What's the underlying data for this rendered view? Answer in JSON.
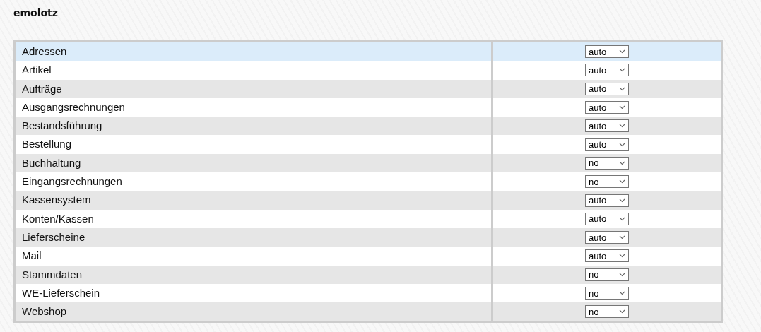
{
  "title": "emolotz",
  "rows": [
    {
      "name": "Adressen",
      "value": "auto",
      "selected": true
    },
    {
      "name": "Artikel",
      "value": "auto",
      "selected": false
    },
    {
      "name": "Aufträge",
      "value": "auto",
      "selected": false
    },
    {
      "name": "Ausgangsrechnungen",
      "value": "auto",
      "selected": false
    },
    {
      "name": "Bestandsführung",
      "value": "auto",
      "selected": false
    },
    {
      "name": "Bestellung",
      "value": "auto",
      "selected": false
    },
    {
      "name": "Buchhaltung",
      "value": "no",
      "selected": false
    },
    {
      "name": "Eingangsrechnungen",
      "value": "no",
      "selected": false
    },
    {
      "name": "Kassensystem",
      "value": "auto",
      "selected": false
    },
    {
      "name": "Konten/Kassen",
      "value": "auto",
      "selected": false
    },
    {
      "name": "Lieferscheine",
      "value": "auto",
      "selected": false
    },
    {
      "name": "Mail",
      "value": "auto",
      "selected": false
    },
    {
      "name": "Stammdaten",
      "value": "no",
      "selected": false
    },
    {
      "name": "WE-Lieferschein",
      "value": "no",
      "selected": false
    },
    {
      "name": "Webshop",
      "value": "no",
      "selected": false
    }
  ]
}
